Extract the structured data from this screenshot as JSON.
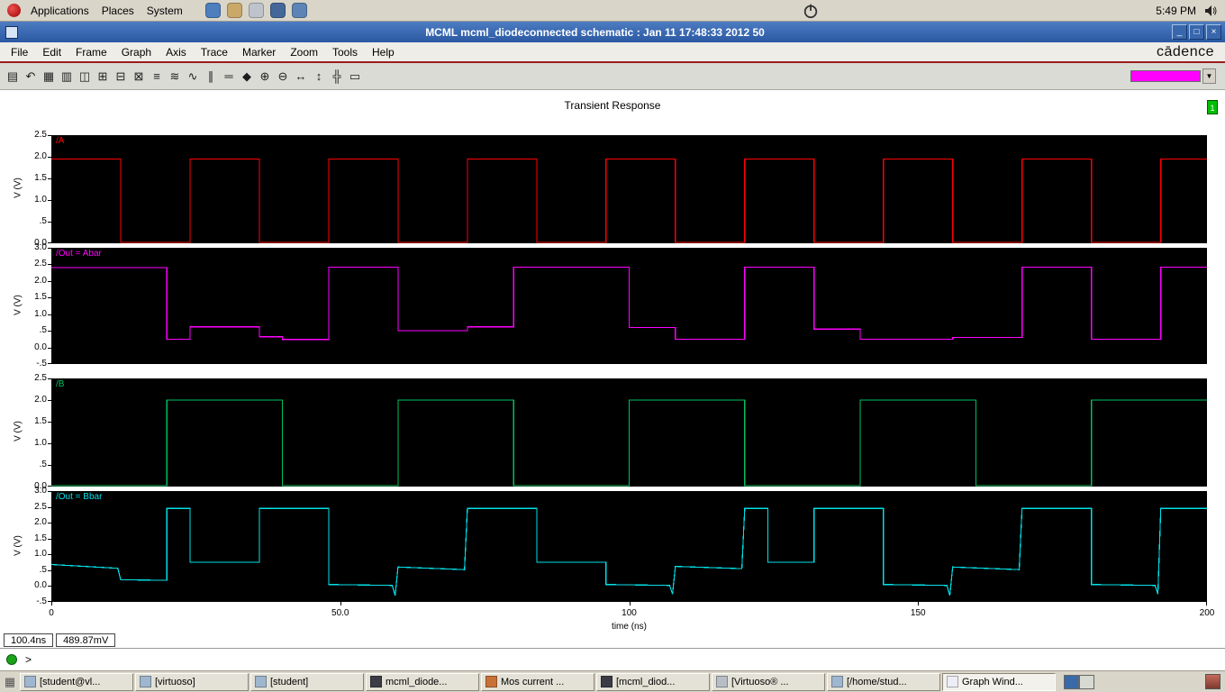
{
  "top_panel": {
    "menus": [
      "Applications",
      "Places",
      "System"
    ],
    "launchers": [
      {
        "name": "web-browser",
        "color": "#4D7EBD"
      },
      {
        "name": "email",
        "color": "#C9A86A"
      },
      {
        "name": "documents",
        "color": "#BFC4CC"
      },
      {
        "name": "terminal",
        "color": "#44679A"
      },
      {
        "name": "help",
        "color": "#5E84B5"
      }
    ],
    "clock": "5:49 PM"
  },
  "window": {
    "titlebar": {
      "title": "MCML mcml_diodeconnected schematic : Jan 11 17:48:33 2012 50",
      "controls": [
        {
          "name": "minimize",
          "glyph": "_"
        },
        {
          "name": "maximize",
          "glyph": "□"
        },
        {
          "name": "close",
          "glyph": "×"
        }
      ]
    },
    "menubar": {
      "items": [
        "File",
        "Edit",
        "Frame",
        "Graph",
        "Axis",
        "Trace",
        "Marker",
        "Zoom",
        "Tools",
        "Help"
      ],
      "brand": "cādence"
    },
    "toolbar": {
      "buttons": [
        {
          "name": "print",
          "glyph": "▤"
        },
        {
          "name": "undo",
          "glyph": "↶"
        },
        {
          "name": "grid",
          "glyph": "▦"
        },
        {
          "name": "strip-list",
          "glyph": "▥"
        },
        {
          "name": "window-split",
          "glyph": "◫"
        },
        {
          "name": "add-subwindow",
          "glyph": "⊞"
        },
        {
          "name": "delete-subwindow",
          "glyph": "⊟"
        },
        {
          "name": "copy-window",
          "glyph": "⊠"
        },
        {
          "name": "strip-mode",
          "glyph": "≡"
        },
        {
          "name": "overlay-mode",
          "glyph": "≋"
        },
        {
          "name": "trace-style",
          "glyph": "∿"
        },
        {
          "name": "vertical-marker",
          "glyph": "∥"
        },
        {
          "name": "horizontal-marker",
          "glyph": "═"
        },
        {
          "name": "point-marker",
          "glyph": "◆"
        },
        {
          "name": "zoom-in",
          "glyph": "⊕"
        },
        {
          "name": "zoom-out",
          "glyph": "⊖"
        },
        {
          "name": "zoom-x",
          "glyph": "↔"
        },
        {
          "name": "zoom-y",
          "glyph": "↕"
        },
        {
          "name": "pan",
          "glyph": "╬"
        },
        {
          "name": "fit",
          "glyph": "▭"
        }
      ],
      "trace_color_swatch": "#FF00FF"
    },
    "page_badge": "1",
    "status_readouts": {
      "x": "100.4ns",
      "y": "489.87mV"
    },
    "prompt": ">"
  },
  "chart_data": {
    "type": "line",
    "title": "Transient Response",
    "xlabel": "time (ns)",
    "xlim": [
      0,
      200
    ],
    "xticks": [
      {
        "v": 0,
        "label": "0"
      },
      {
        "v": 50,
        "label": "50.0"
      },
      {
        "v": 100,
        "label": "100"
      },
      {
        "v": 150,
        "label": "150"
      },
      {
        "v": 200,
        "label": "200"
      }
    ],
    "legend_position": "top-left-per-strip",
    "grid": false,
    "strips": [
      {
        "name": "/A",
        "color": "#FF0000",
        "ylabel": "V (V)",
        "ylim": [
          0,
          2.5
        ],
        "yticks": [
          {
            "v": 2.5,
            "label": "2.5"
          },
          {
            "v": 2.0,
            "label": "2.0"
          },
          {
            "v": 1.5,
            "label": "1.5"
          },
          {
            "v": 1.0,
            "label": "1.0"
          },
          {
            "v": 0.5,
            "label": ".5"
          },
          {
            "v": 0.0,
            "label": "0.0"
          }
        ],
        "points": [
          [
            0,
            1.95
          ],
          [
            12,
            1.95
          ],
          [
            12,
            0.02
          ],
          [
            24,
            0.02
          ],
          [
            24,
            1.95
          ],
          [
            36,
            1.95
          ],
          [
            36,
            0.02
          ],
          [
            48,
            0.02
          ],
          [
            48,
            1.95
          ],
          [
            60,
            1.95
          ],
          [
            60,
            0.02
          ],
          [
            72,
            0.02
          ],
          [
            72,
            1.95
          ],
          [
            84,
            1.95
          ],
          [
            84,
            0.02
          ],
          [
            96,
            0.02
          ],
          [
            96,
            1.95
          ],
          [
            108,
            1.95
          ],
          [
            108,
            0.02
          ],
          [
            120,
            0.02
          ],
          [
            120,
            1.95
          ],
          [
            132,
            1.95
          ],
          [
            132,
            0.02
          ],
          [
            144,
            0.02
          ],
          [
            144,
            1.95
          ],
          [
            156,
            1.95
          ],
          [
            156,
            0.02
          ],
          [
            168,
            0.02
          ],
          [
            168,
            1.95
          ],
          [
            180,
            1.95
          ],
          [
            180,
            0.02
          ],
          [
            192,
            0.02
          ],
          [
            192,
            1.95
          ],
          [
            200,
            1.95
          ]
        ]
      },
      {
        "name": "/Out = Abar",
        "color": "#FF00FF",
        "ylabel": "V (V)",
        "ylim": [
          -0.5,
          3.0
        ],
        "yticks": [
          {
            "v": 3.0,
            "label": "3.0"
          },
          {
            "v": 2.5,
            "label": "2.5"
          },
          {
            "v": 2.0,
            "label": "2.0"
          },
          {
            "v": 1.5,
            "label": "1.5"
          },
          {
            "v": 1.0,
            "label": "1.0"
          },
          {
            "v": 0.5,
            "label": ".5"
          },
          {
            "v": 0.0,
            "label": "0.0"
          },
          {
            "v": -0.5,
            "label": "-.5"
          }
        ],
        "points": [
          [
            0,
            2.4
          ],
          [
            20,
            2.4
          ],
          [
            20,
            0.25
          ],
          [
            24,
            0.25
          ],
          [
            24,
            0.62
          ],
          [
            36,
            0.62
          ],
          [
            36,
            0.32
          ],
          [
            40,
            0.32
          ],
          [
            40,
            0.24
          ],
          [
            48,
            0.24
          ],
          [
            48,
            2.42
          ],
          [
            60,
            2.42
          ],
          [
            60,
            0.5
          ],
          [
            72,
            0.5
          ],
          [
            72,
            0.62
          ],
          [
            80,
            0.62
          ],
          [
            80,
            2.42
          ],
          [
            100,
            2.42
          ],
          [
            100,
            0.6
          ],
          [
            108,
            0.6
          ],
          [
            108,
            0.25
          ],
          [
            120,
            0.25
          ],
          [
            120,
            2.42
          ],
          [
            132,
            2.42
          ],
          [
            132,
            0.55
          ],
          [
            140,
            0.55
          ],
          [
            140,
            0.25
          ],
          [
            156,
            0.25
          ],
          [
            156,
            0.3
          ],
          [
            168,
            0.3
          ],
          [
            168,
            2.42
          ],
          [
            180,
            2.42
          ],
          [
            180,
            0.25
          ],
          [
            192,
            0.25
          ],
          [
            192,
            2.42
          ],
          [
            200,
            2.42
          ]
        ]
      },
      {
        "name": "/B",
        "color": "#00C060",
        "ylabel": "V (V)",
        "ylim": [
          0,
          2.5
        ],
        "yticks": [
          {
            "v": 2.5,
            "label": "2.5"
          },
          {
            "v": 2.0,
            "label": "2.0"
          },
          {
            "v": 1.5,
            "label": "1.5"
          },
          {
            "v": 1.0,
            "label": "1.0"
          },
          {
            "v": 0.5,
            "label": ".5"
          },
          {
            "v": 0.0,
            "label": "0.0"
          }
        ],
        "points": [
          [
            0,
            0.02
          ],
          [
            20,
            0.02
          ],
          [
            20,
            2.0
          ],
          [
            40,
            2.0
          ],
          [
            40,
            0.02
          ],
          [
            60,
            0.02
          ],
          [
            60,
            2.0
          ],
          [
            80,
            2.0
          ],
          [
            80,
            0.02
          ],
          [
            100,
            0.02
          ],
          [
            100,
            2.0
          ],
          [
            120,
            2.0
          ],
          [
            120,
            0.02
          ],
          [
            140,
            0.02
          ],
          [
            140,
            2.0
          ],
          [
            160,
            2.0
          ],
          [
            160,
            0.02
          ],
          [
            180,
            0.02
          ],
          [
            180,
            2.0
          ],
          [
            200,
            2.0
          ]
        ]
      },
      {
        "name": "/Out = Bbar",
        "color": "#00E0E8",
        "ylabel": "V (V)",
        "ylim": [
          -0.5,
          3.0
        ],
        "yticks": [
          {
            "v": 3.0,
            "label": "3.0"
          },
          {
            "v": 2.5,
            "label": "2.5"
          },
          {
            "v": 2.0,
            "label": "2.0"
          },
          {
            "v": 1.5,
            "label": "1.5"
          },
          {
            "v": 1.0,
            "label": "1.0"
          },
          {
            "v": 0.5,
            "label": ".5"
          },
          {
            "v": 0.0,
            "label": "0.0"
          },
          {
            "v": -0.5,
            "label": "-.5"
          }
        ],
        "points": [
          [
            0,
            0.68
          ],
          [
            11.5,
            0.56
          ],
          [
            12,
            0.2
          ],
          [
            20,
            0.18
          ],
          [
            20,
            2.45
          ],
          [
            24,
            2.45
          ],
          [
            24,
            0.75
          ],
          [
            36,
            0.75
          ],
          [
            36,
            2.45
          ],
          [
            48,
            2.45
          ],
          [
            48,
            0.05
          ],
          [
            59,
            0.02
          ],
          [
            59.5,
            -0.3
          ],
          [
            60,
            0.6
          ],
          [
            71.5,
            0.52
          ],
          [
            72,
            2.45
          ],
          [
            84,
            2.45
          ],
          [
            84,
            0.75
          ],
          [
            96,
            0.75
          ],
          [
            96,
            0.05
          ],
          [
            107,
            0.02
          ],
          [
            107.5,
            -0.25
          ],
          [
            108,
            0.62
          ],
          [
            119.5,
            0.55
          ],
          [
            120,
            2.45
          ],
          [
            124,
            2.45
          ],
          [
            124,
            0.75
          ],
          [
            132,
            0.75
          ],
          [
            132,
            2.45
          ],
          [
            144,
            2.45
          ],
          [
            144,
            0.05
          ],
          [
            155,
            0.02
          ],
          [
            155.5,
            -0.3
          ],
          [
            156,
            0.6
          ],
          [
            167.5,
            0.52
          ],
          [
            168,
            2.45
          ],
          [
            180,
            2.45
          ],
          [
            180,
            0.05
          ],
          [
            191,
            0.02
          ],
          [
            191.5,
            -0.25
          ],
          [
            192,
            2.45
          ],
          [
            200,
            2.45
          ]
        ]
      }
    ]
  },
  "taskbar": {
    "items": [
      {
        "label": "[student@vl...",
        "icon": "terminal",
        "color": "#9FB6CF",
        "active": false
      },
      {
        "label": "[virtuoso]",
        "icon": "terminal",
        "color": "#9FB6CF",
        "active": false
      },
      {
        "label": "[student]",
        "icon": "terminal",
        "color": "#9FB6CF",
        "active": false
      },
      {
        "label": "mcml_diode...",
        "icon": "schematic",
        "color": "#3C3C46",
        "active": false
      },
      {
        "label": "Mos current ...",
        "icon": "document",
        "color": "#C87137",
        "active": false
      },
      {
        "label": "[mcml_diod...",
        "icon": "schematic",
        "color": "#3C3C46",
        "active": false
      },
      {
        "label": "[Virtuoso® ...",
        "icon": "virtuoso",
        "color": "#B8BEC6",
        "active": false
      },
      {
        "label": "[/home/stud...",
        "icon": "terminal",
        "color": "#9FB6CF",
        "active": false
      },
      {
        "label": "Graph Wind...",
        "icon": "graph",
        "color": "#EDEDF5",
        "active": true
      }
    ]
  }
}
